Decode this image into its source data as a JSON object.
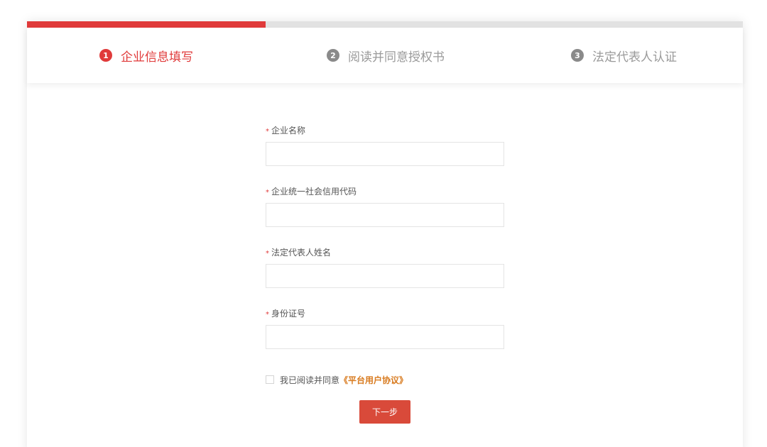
{
  "progress": {
    "fraction": 0.333
  },
  "steps": [
    {
      "number": "1",
      "label": "企业信息填写",
      "active": true
    },
    {
      "number": "2",
      "label": "阅读并同意授权书",
      "active": false
    },
    {
      "number": "3",
      "label": "法定代表人认证",
      "active": false
    }
  ],
  "form": {
    "required_mark": "*",
    "fields": [
      {
        "label": "企业名称",
        "value": "",
        "placeholder": ""
      },
      {
        "label": "企业统一社会信用代码",
        "value": "",
        "placeholder": ""
      },
      {
        "label": "法定代表人姓名",
        "value": "",
        "placeholder": ""
      },
      {
        "label": "身份证号",
        "value": "",
        "placeholder": ""
      }
    ],
    "agreement": {
      "checked": false,
      "prefix": "我已阅读并同意",
      "link": "《平台用户协议》"
    },
    "next_label": "下一步"
  },
  "colors": {
    "accent": "#e03a3a",
    "button": "#d94a3a",
    "link": "#d87a1e",
    "inactive": "#9a9a9a"
  }
}
